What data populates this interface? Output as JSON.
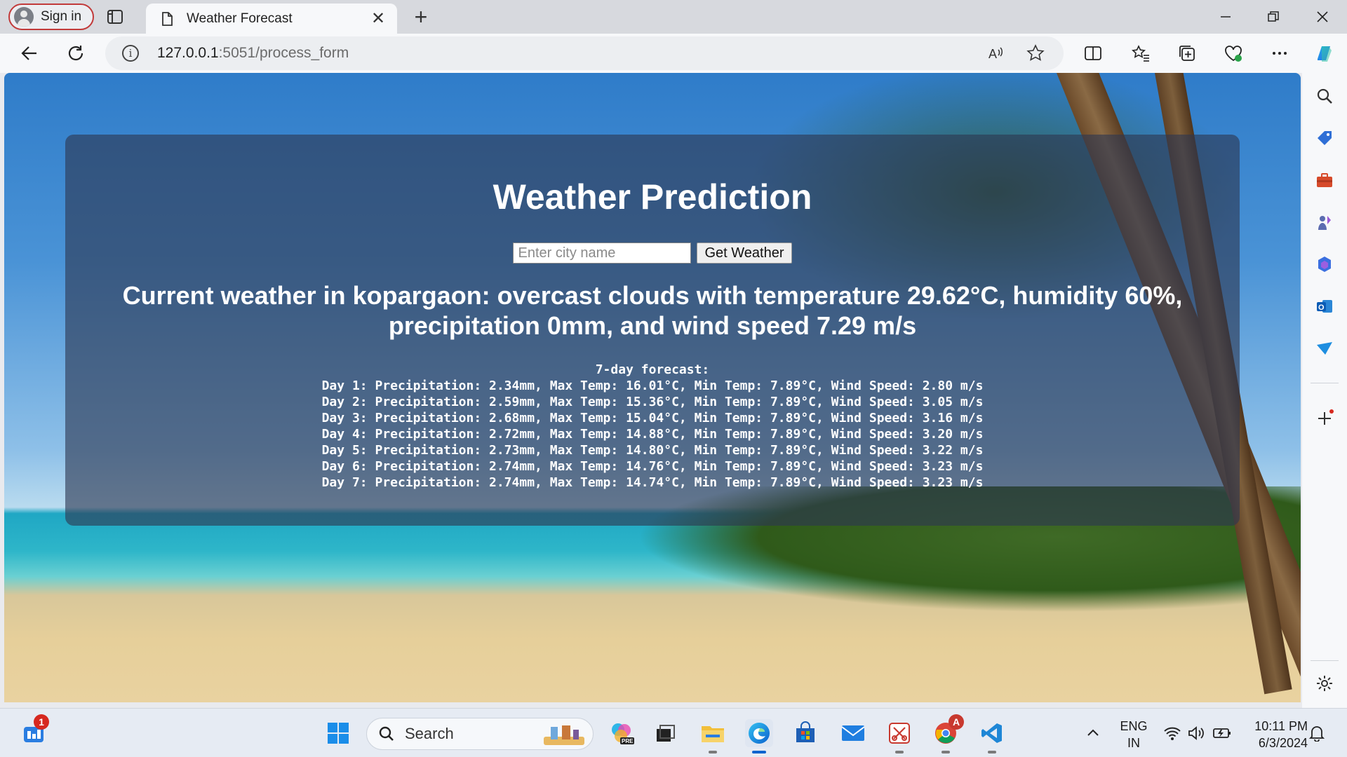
{
  "browser": {
    "signin_label": "Sign in",
    "tab_title": "Weather Forecast",
    "url_host": "127.0.0.1",
    "url_path": ":5051/process_form"
  },
  "page": {
    "heading": "Weather Prediction",
    "city_placeholder": "Enter city name",
    "button_label": "Get Weather",
    "current_weather": "Current weather in kopargaon: overcast clouds with temperature 29.62°C, humidity 60%, precipitation 0mm, and wind speed 7.29 m/s",
    "forecast_title": "7-day forecast:",
    "forecast_days": [
      "Day 1: Precipitation: 2.34mm, Max Temp: 16.01°C, Min Temp: 7.89°C, Wind Speed: 2.80 m/s",
      "Day 2: Precipitation: 2.59mm, Max Temp: 15.36°C, Min Temp: 7.89°C, Wind Speed: 3.05 m/s",
      "Day 3: Precipitation: 2.68mm, Max Temp: 15.04°C, Min Temp: 7.89°C, Wind Speed: 3.16 m/s",
      "Day 4: Precipitation: 2.72mm, Max Temp: 14.88°C, Min Temp: 7.89°C, Wind Speed: 3.20 m/s",
      "Day 5: Precipitation: 2.73mm, Max Temp: 14.80°C, Min Temp: 7.89°C, Wind Speed: 3.22 m/s",
      "Day 6: Precipitation: 2.74mm, Max Temp: 14.76°C, Min Temp: 7.89°C, Wind Speed: 3.23 m/s",
      "Day 7: Precipitation: 2.74mm, Max Temp: 14.74°C, Min Temp: 7.89°C, Wind Speed: 3.23 m/s"
    ]
  },
  "taskbar": {
    "search_label": "Search",
    "widget_badge": "1",
    "chrome_badge": "A",
    "lang_line1": "ENG",
    "lang_line2": "IN",
    "time": "10:11 PM",
    "date": "6/3/2024"
  },
  "icons": {
    "accent": "#0b63ce",
    "badge": "#d6281f"
  }
}
